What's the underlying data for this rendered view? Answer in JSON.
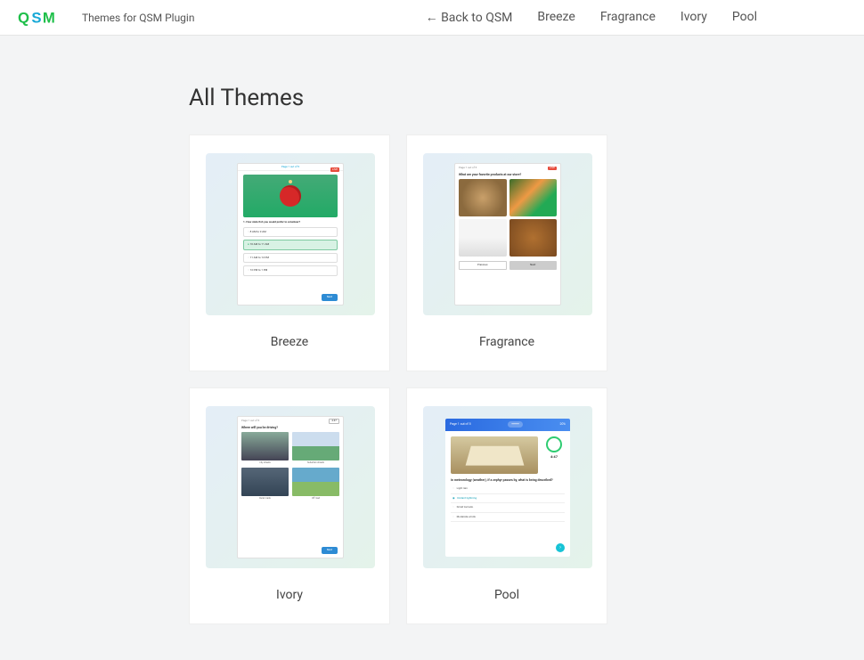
{
  "header": {
    "logo_text": "QSM",
    "tagline": "Themes for QSM Plugin",
    "nav": [
      {
        "label": "← Back to QSM"
      },
      {
        "label": "Breeze"
      },
      {
        "label": "Fragrance"
      },
      {
        "label": "Ivory"
      },
      {
        "label": "Pool"
      }
    ]
  },
  "page": {
    "heading": "All Themes"
  },
  "themes": [
    {
      "name": "Breeze",
      "preview": {
        "page_indicator": "Page 1 out of 5",
        "question": "1. How slate fish you would prefer to volunteer?",
        "options": [
          "8 AM to 9 AM",
          "10 AM to 11 AM",
          "11 AM to 12 PM",
          "12 PM to 1 PM"
        ],
        "selected_index": 1,
        "next_label": "Next"
      }
    },
    {
      "name": "Fragrance",
      "preview": {
        "page_indicator": "Page 1 out of 5",
        "question": "What are your favorite products at our store?",
        "images": [
          "bread",
          "vegetables",
          "milk-bottles",
          "nuts"
        ],
        "prev_label": "Previous",
        "next_label": "Next"
      }
    },
    {
      "name": "Ivory",
      "preview": {
        "page_indicator": "Page 1 out of 5",
        "timer": "4:47",
        "question": "Where will you be driving?",
        "items": [
          {
            "caption": "City streets"
          },
          {
            "caption": "Suburban streets"
          },
          {
            "caption": "Rural roads"
          },
          {
            "caption": "Off road"
          }
        ],
        "next_label": "Next"
      }
    },
    {
      "name": "Pool",
      "preview": {
        "page_indicator": "Page 1 out of 5",
        "progress_label": "20%",
        "timer": "4:47",
        "question": "In meteorology (weather), if a zephyr passes by, what is being described?",
        "options": [
          "Light rain",
          "Distant lightning",
          "Small tornado",
          "Moderate winds"
        ],
        "selected_index": 1
      }
    }
  ]
}
